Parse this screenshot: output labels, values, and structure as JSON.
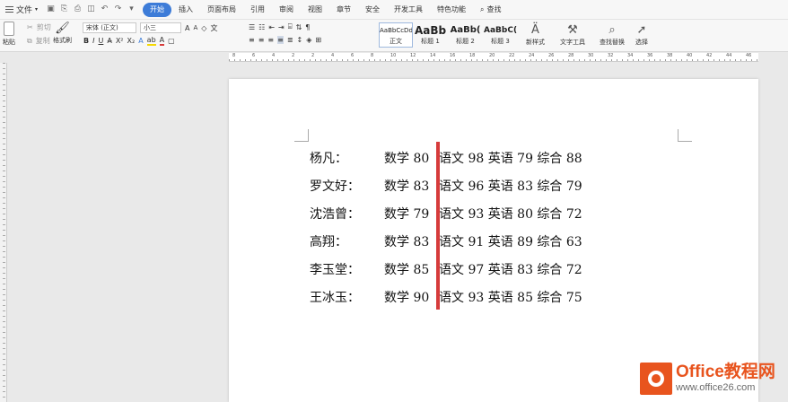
{
  "menu": {
    "file_label": "文件",
    "tabs": [
      "开始",
      "插入",
      "页面布局",
      "引用",
      "审阅",
      "视图",
      "章节",
      "安全",
      "开发工具",
      "特色功能"
    ],
    "active_tab": "开始",
    "search_label": "查找"
  },
  "ribbon": {
    "paste": "粘贴",
    "cut": "剪切",
    "copy": "复制",
    "format_painter": "格式刷",
    "font_name": "宋体 (正文)",
    "font_size": "小三",
    "styles": [
      {
        "sample": "AaBbCcDd",
        "label": "正文"
      },
      {
        "sample": "AaBb",
        "label": "标题 1"
      },
      {
        "sample": "AaBb(",
        "label": "标题 2"
      },
      {
        "sample": "AaBbC(",
        "label": "标题 3"
      }
    ],
    "new_style": "新样式",
    "text_tools": "文字工具",
    "find_replace": "查找替换",
    "select": "选择"
  },
  "ruler_labels": [
    "8",
    "6",
    "4",
    "2",
    "2",
    "4",
    "6",
    "8",
    "10",
    "12",
    "14",
    "16",
    "18",
    "20",
    "22",
    "24",
    "26",
    "28",
    "30",
    "32",
    "34",
    "36",
    "38",
    "40",
    "42",
    "44",
    "46"
  ],
  "document": {
    "rows": [
      {
        "name": "杨凡：",
        "math": "数学 80",
        "rest": "语文 98 英语 79 综合 88"
      },
      {
        "name": "罗文好：",
        "math": "数学 83",
        "rest": "语文 96 英语 83 综合 79"
      },
      {
        "name": "沈浩曾：",
        "math": "数学 79",
        "rest": "语文 93 英语 80 综合 72"
      },
      {
        "name": "高翔：",
        "math": "数学 83",
        "rest": "语文 91 英语 89 综合 63"
      },
      {
        "name": "李玉堂：",
        "math": "数学 85",
        "rest": "语文 97 英语 83 综合 72"
      },
      {
        "name": "王冰玉：",
        "math": "数学 90",
        "rest": "语文 93 英语 85 综合 75"
      }
    ],
    "selection_bar_color": "#d63b3b"
  },
  "watermark": {
    "title": "Office教程网",
    "url": "www.office26.com",
    "color": "#e8541e"
  }
}
